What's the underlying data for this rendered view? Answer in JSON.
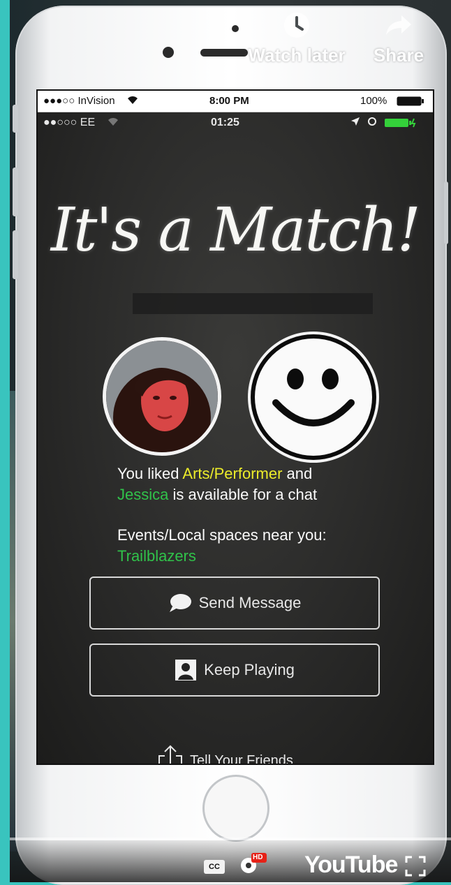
{
  "youtube_overlay": {
    "watch_later_label": "Watch later",
    "share_label": "Share",
    "brand_label": "YouTube",
    "cc_label": "CC",
    "hd_badge": "HD"
  },
  "status_bar_outer": {
    "carrier": "●●●○○ InVision",
    "time": "8:00 PM",
    "battery": "100%"
  },
  "status_bar_inner": {
    "carrier": "●●○○○ EE",
    "time": "01:25"
  },
  "match_screen": {
    "title": "It's a Match!",
    "liked_prefix": "You liked ",
    "liked_category": "Arts/Performer",
    "liked_suffix": " and",
    "match_name": "Jessica",
    "available_text": " is available for a chat",
    "events_label": "Events/Local spaces near you:",
    "event_name": "Trailblazers",
    "send_message_label": "Send Message",
    "keep_playing_label": "Keep Playing",
    "tell_friends_label": "Tell Your Friends"
  },
  "colors": {
    "page_bg": "#39c4be",
    "highlight_yellow": "#ecec2a",
    "highlight_green": "#30c24a",
    "screen_bg": "#2a2a29"
  }
}
